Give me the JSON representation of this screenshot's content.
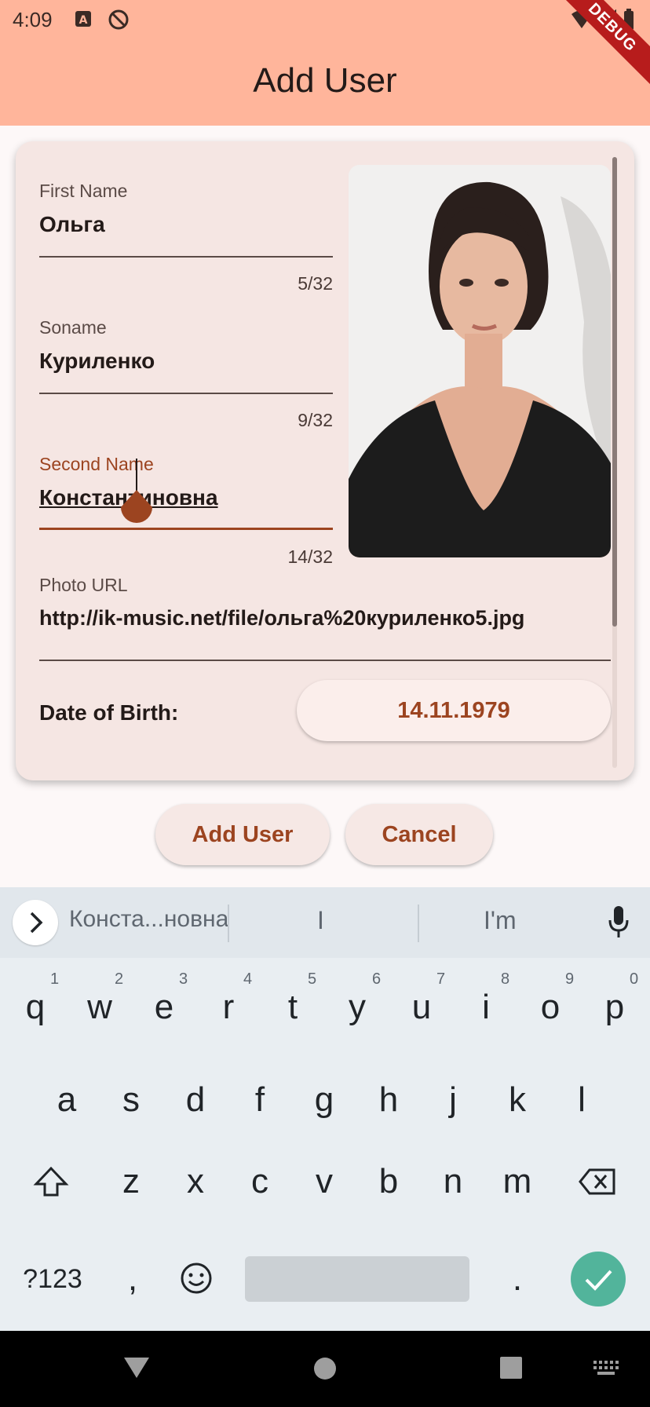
{
  "status_bar": {
    "time": "4:09"
  },
  "debug_banner": "DEBUG",
  "app_bar": {
    "title": "Add User"
  },
  "form": {
    "first_name": {
      "label": "First Name",
      "value": "Ольга",
      "counter": "5/32"
    },
    "soname": {
      "label": "Soname",
      "value": "Куриленко",
      "counter": "9/32"
    },
    "second_name": {
      "label": "Second Name",
      "value": "Константиновна",
      "counter": "14/32"
    },
    "photo_url": {
      "label": "Photo URL",
      "value": "http://ik-music.net/file/ольга%20куриленко5.jpg"
    },
    "date_of_birth": {
      "label": "Date of Birth:",
      "value": "14.11.1979"
    }
  },
  "actions": {
    "add_user": "Add User",
    "cancel": "Cancel"
  },
  "keyboard": {
    "suggestions": [
      "Конста...новна",
      "I",
      "I'm"
    ],
    "row1": [
      "q",
      "w",
      "e",
      "r",
      "t",
      "y",
      "u",
      "i",
      "o",
      "p"
    ],
    "row1_hints": [
      "1",
      "2",
      "3",
      "4",
      "5",
      "6",
      "7",
      "8",
      "9",
      "0"
    ],
    "row2": [
      "a",
      "s",
      "d",
      "f",
      "g",
      "h",
      "j",
      "k",
      "l"
    ],
    "row3": [
      "z",
      "x",
      "c",
      "v",
      "b",
      "n",
      "m"
    ],
    "symbols_key": "?123",
    "comma": ",",
    "period": "."
  },
  "colors": {
    "app_bar": "#ffb59b",
    "accent": "#9c4420",
    "card": "#f5e6e3",
    "enter_key": "#52b49b"
  }
}
